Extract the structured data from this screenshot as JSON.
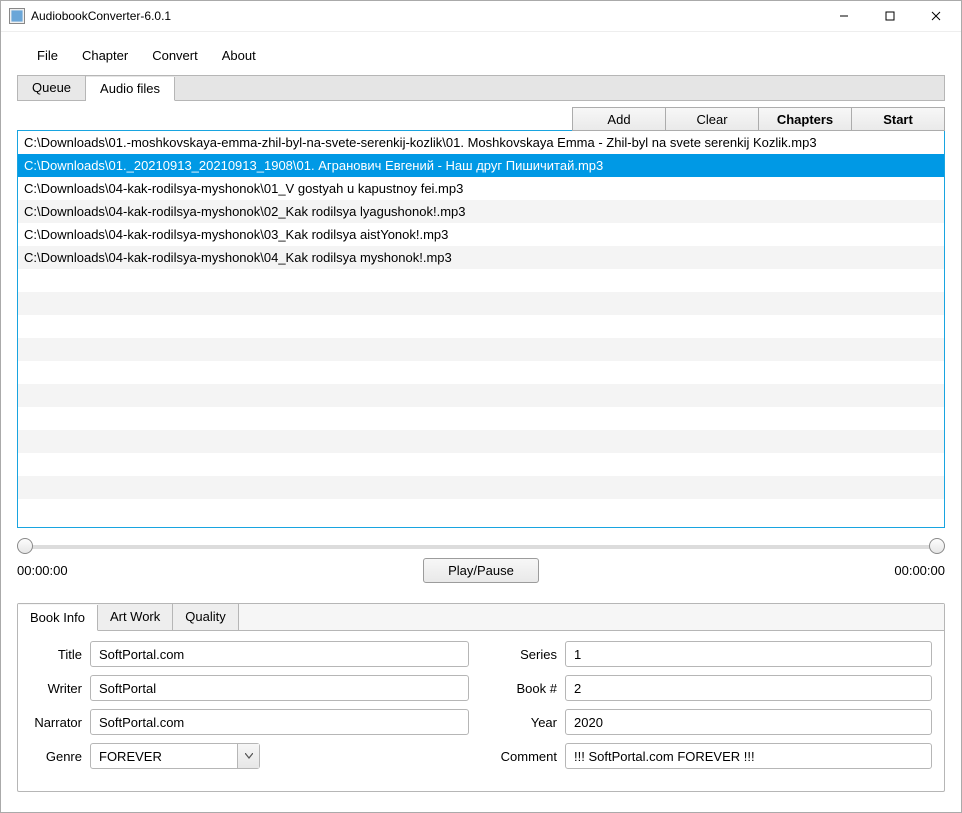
{
  "window": {
    "title": "AudiobookConverter-6.0.1"
  },
  "menu": {
    "file": "File",
    "chapter": "Chapter",
    "convert": "Convert",
    "about": "About"
  },
  "tabs": {
    "queue": "Queue",
    "audio_files": "Audio files"
  },
  "toolbar": {
    "add": "Add",
    "clear": "Clear",
    "chapters": "Chapters",
    "start": "Start"
  },
  "files": [
    "C:\\Downloads\\01.-moshkovskaya-emma-zhil-byl-na-svete-serenkij-kozlik\\01. Moshkovskaya Emma - Zhil-byl na svete serenkij Kozlik.mp3",
    "C:\\Downloads\\01._20210913_20210913_1908\\01. Агранович Евгений - Наш друг Пишичитай.mp3",
    "C:\\Downloads\\04-kak-rodilsya-myshonok\\01_V gostyah u kapustnoy fei.mp3",
    "C:\\Downloads\\04-kak-rodilsya-myshonok\\02_Kak rodilsya lyagushonok!.mp3",
    "C:\\Downloads\\04-kak-rodilsya-myshonok\\03_Kak rodilsya aistYonok!.mp3",
    "C:\\Downloads\\04-kak-rodilsya-myshonok\\04_Kak rodilsya myshonok!.mp3"
  ],
  "selected_index": 1,
  "playback": {
    "left_time": "00:00:00",
    "right_time": "00:00:00",
    "button": "Play/Pause"
  },
  "bottom_tabs": {
    "book_info": "Book Info",
    "art_work": "Art Work",
    "quality": "Quality"
  },
  "form": {
    "labels": {
      "title": "Title",
      "writer": "Writer",
      "narrator": "Narrator",
      "genre": "Genre",
      "series": "Series",
      "book_no": "Book #",
      "year": "Year",
      "comment": "Comment"
    },
    "values": {
      "title": "SoftPortal.com",
      "writer": "SoftPortal",
      "narrator": "SoftPortal.com",
      "genre": "FOREVER",
      "series": "1",
      "book_no": "2",
      "year": "2020",
      "comment": "!!! SoftPortal.com FOREVER !!!"
    }
  }
}
